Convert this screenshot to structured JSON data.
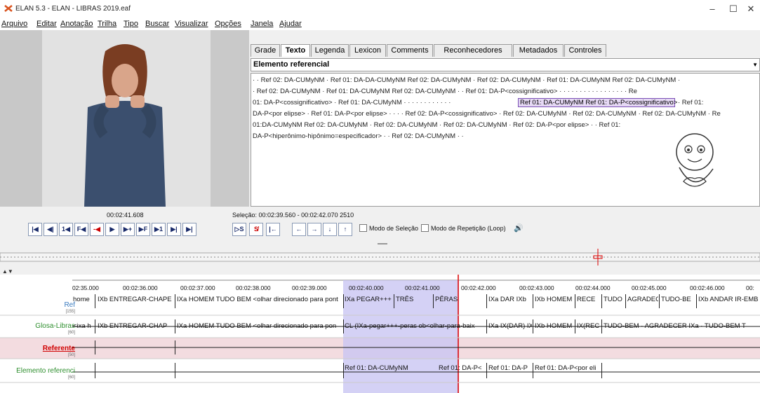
{
  "window": {
    "title": "ELAN 5.3 - ELAN - LIBRAS 2019.eaf",
    "min": "–",
    "max": "☐",
    "close": "✕"
  },
  "menu": [
    "Arquivo",
    "Editar",
    "Anotação",
    "Trilha",
    "Tipo",
    "Buscar",
    "Visualizar",
    "Opções",
    "Janela",
    "Ajudar"
  ],
  "tabs": [
    "Grade",
    "Texto",
    "Legenda",
    "Lexicon",
    "Comments",
    "Reconhecedores",
    "Metadados",
    "Controles"
  ],
  "active_tab": "Texto",
  "tier_selected": "Elemento referencial",
  "text_lines": [
    "· · Ref 02: DA-CUMyNM · Ref 01: DA-DA-CUMyNM            Ref 02: DA-CUMyNM · Ref 02: DA-CUMyNM · Ref 01: DA-CUMyNM      Ref 02: DA-CUMyNM ·",
    "· Ref 02: DA-CUMyNM · Ref 01: DA-CUMyNM       Ref 02: DA-CUMyNM ·  · Ref 01: DA-P<cossignificativo> · · · · · · · · · · · · · · · · · Re",
    "01: DA-P<cossignificativo> · Ref 01: DA-CUMyNM · · · · · · · · · · · ·",
    "DA-P<por elipse> · Ref 01: DA-P<por elipse> · · · · Ref 02: DA-P<cossignificativo> · Ref 02: DA-CUMyNM · Ref 02: DA-CUMyNM · Ref 02: DA-CUMyNM · Re",
    "01:DA-CUMyNM    Ref 02: DA-CUMyNM · Ref 02: DA-CUMyNM · Ref 02: DA-CUMyNM · Ref 02: DA-P<por elipse> · · Ref 01:",
    "DA-P<hiperônimo-hipônimo=especificador> · · Ref 02: DA-CUMyNM · ·"
  ],
  "highlight_text": "Ref 01: DA-CUMyNM          Ref 01: DA-P<cossignificativo>",
  "after_highlight": "· Ref 01:",
  "player": {
    "current_time": "00:02:41.608",
    "selection": "Seleção: 00:02:39.560 - 00:02:42.070  2510",
    "buttons": [
      "|◀",
      "◀|",
      "1◀",
      "F◀",
      "-◀",
      "▶",
      "▶+",
      "▶F",
      "▶1",
      "▶|",
      "▶|"
    ],
    "sel_buttons": [
      "▷S",
      "S̸",
      "|←"
    ],
    "arrows": [
      "←",
      "→",
      "↓",
      "↑"
    ],
    "mode_selection": "Modo de Seleção",
    "mode_loop": "Modo de Repetição (Loop)",
    "volume_icon": "🔊"
  },
  "ruler": [
    "02:35.000",
    "00:02:36.000",
    "00:02:37.000",
    "00:02:38.000",
    "00:02:39.000",
    "00:02:40.000",
    "00:02:41.000",
    "00:02:42.000",
    "00:02:43.000",
    "00:02:44.000",
    "00:02:45.000",
    "00:02:46.000",
    "00:"
  ],
  "tiers": [
    {
      "name": "Ref",
      "count": "[155]",
      "color": "#3a7bbf"
    },
    {
      "name": "Glosa-Libras",
      "count": "[60]",
      "color": "#2f8f2f"
    },
    {
      "name": "Referente",
      "count": "[50]",
      "color": "#d00000"
    },
    {
      "name": "Elemento referenci",
      "count": "[60]",
      "color": "#2f8f2f"
    }
  ],
  "ref_annotations": [
    "home",
    "IXb ENTREGAR-CHAPE",
    "IXa HOMEM TUDO BEM <olhar direcionado para pont",
    "IXa PEGAR+++",
    "TRÊS",
    "PÊRAS",
    "IXa DAR IXb",
    "IXb HOMEM",
    "RECE",
    "TUDO",
    "AGRADEC",
    "TUDO-BE",
    "IXb ANDAR IR-EMB"
  ],
  "glosa_annotations": [
    "<ixa h",
    "IXb ENTREGAR-CHAP",
    "IXa HOMEM TUDO BEM <olhar direcionado para pon",
    "CL (IXa-pegar+++-peras  ob<olhar-para-baix",
    "IXa IX(DAR) IX",
    "IXb HOMEM",
    "IX(REC",
    "TUDO-BEM · AGRADECER IXa · TUDO-BEM T"
  ],
  "elem_annotations": [
    "Ref 01: DA-CUMyNM",
    "Ref 01: DA-P<",
    "Ref 01: DA-P",
    "Ref 01: DA-P<por eli"
  ]
}
